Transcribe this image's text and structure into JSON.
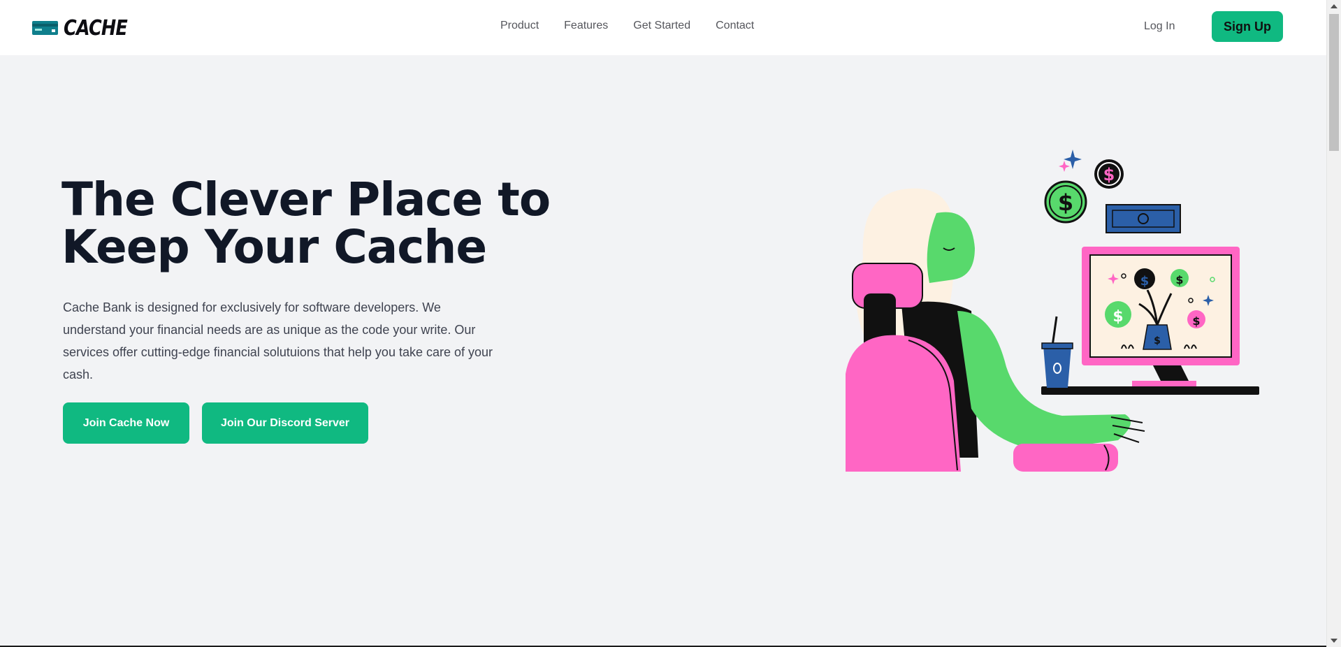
{
  "brand": {
    "name": "CACHE",
    "logo_icon": "credit-card-icon"
  },
  "nav": {
    "links": [
      "Product",
      "Features",
      "Get Started",
      "Contact"
    ],
    "login": "Log In",
    "signup": "Sign Up"
  },
  "hero": {
    "title": "The Clever Place to Keep Your Cache",
    "description": "Cache Bank is designed for exclusively for software developers. We understand your financial needs are as unique as the code your write. Our services offer cutting-edge financial solutuions that help you take care of your cash.",
    "primary_button": "Join Cache Now",
    "secondary_button": "Join Our Discord Server"
  },
  "illustration": {
    "icon": "developer-at-desk-illustration"
  },
  "colors": {
    "accent": "#10b981",
    "heading": "#111827",
    "pink": "#ff66c4",
    "green": "#58d96c",
    "blue": "#2b5fa8"
  }
}
